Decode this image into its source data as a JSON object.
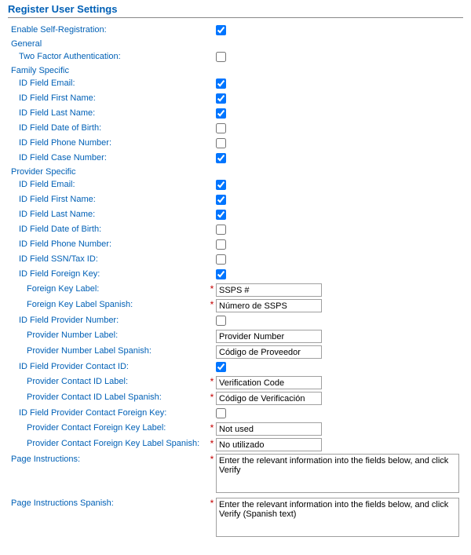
{
  "title": "Register User Settings",
  "required_marker": "*",
  "labels": {
    "enableSelfReg": "Enable Self-Registration:",
    "general": "General",
    "twoFactor": "Two Factor Authentication:",
    "familySpecific": "Family Specific",
    "famEmail": "ID Field Email:",
    "famFirst": "ID Field First Name:",
    "famLast": "ID Field Last Name:",
    "famDOB": "ID Field Date of Birth:",
    "famPhone": "ID Field Phone Number:",
    "famCase": "ID Field Case Number:",
    "providerSpecific": "Provider Specific",
    "provEmail": "ID Field Email:",
    "provFirst": "ID Field First Name:",
    "provLast": "ID Field Last Name:",
    "provDOB": "ID Field Date of Birth:",
    "provPhone": "ID Field Phone Number:",
    "provSSN": "ID Field SSN/Tax ID:",
    "provFK": "ID Field Foreign Key:",
    "fkLabel": "Foreign Key Label:",
    "fkLabelEs": "Foreign Key Label Spanish:",
    "provNum": "ID Field Provider Number:",
    "provNumLabel": "Provider Number Label:",
    "provNumLabelEs": "Provider Number Label Spanish:",
    "provContact": "ID Field Provider Contact ID:",
    "provContactLabel": "Provider Contact ID Label:",
    "provContactLabelEs": "Provider Contact ID Label Spanish:",
    "provContactFK": "ID Field Provider Contact Foreign Key:",
    "provContactFKLabel": "Provider Contact Foreign Key Label:",
    "provContactFKLabelEs": "Provider Contact Foreign Key Label Spanish:",
    "pageInstr": "Page Instructions:",
    "pageInstrEs": "Page Instructions Spanish:"
  },
  "values": {
    "fkLabel": "SSPS #",
    "fkLabelEs": "Número de SSPS",
    "provNumLabel": "Provider Number",
    "provNumLabelEs": "Código de Proveedor",
    "provContactLabel": "Verification Code",
    "provContactLabelEs": "Código de Verificación",
    "provContactFKLabel": "Not used",
    "provContactFKLabelEs": "No utilizado",
    "pageInstr": "Enter the relevant information into the fields below, and click Verify",
    "pageInstrEs": "Enter the relevant information into the fields below, and click Verify (Spanish text)"
  }
}
